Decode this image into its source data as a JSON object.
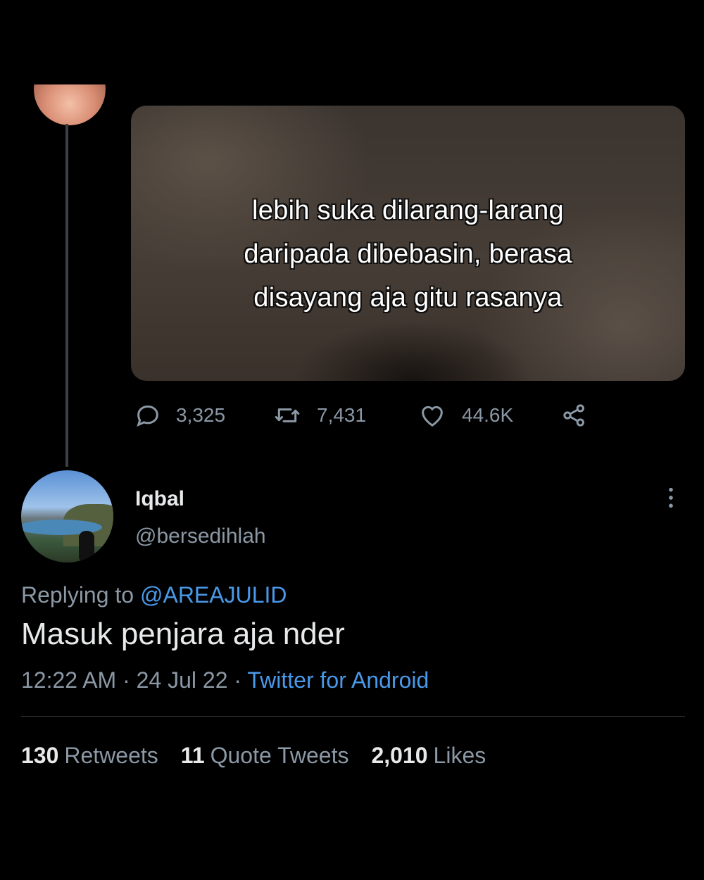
{
  "parent_tweet": {
    "media_caption": "lebih suka dilarang-larang\ndaripada dibebasin, berasa\ndisayang aja gitu rasanya",
    "actions": {
      "replies": "3,325",
      "retweets": "7,431",
      "likes": "44.6K"
    }
  },
  "reply_tweet": {
    "display_name": "Iqbal",
    "handle": "@bersedihlah",
    "replying_prefix": "Replying to ",
    "replying_to": "@AREAJULID",
    "text": "Masuk penjara aja nder",
    "time": "12:22 AM",
    "separator": " · ",
    "date": "24 Jul 22",
    "source": "Twitter for Android",
    "stats": {
      "retweets_count": "130",
      "retweets_label": "Retweets",
      "quotes_count": "11",
      "quotes_label": "Quote Tweets",
      "likes_count": "2,010",
      "likes_label": "Likes"
    }
  },
  "colors": {
    "background": "#000000",
    "text_primary": "#e7e9ea",
    "text_secondary": "#8b98a5",
    "link": "#4a99e9"
  },
  "icons": [
    "reply-icon",
    "retweet-icon",
    "like-icon",
    "share-icon",
    "more-options-icon"
  ]
}
